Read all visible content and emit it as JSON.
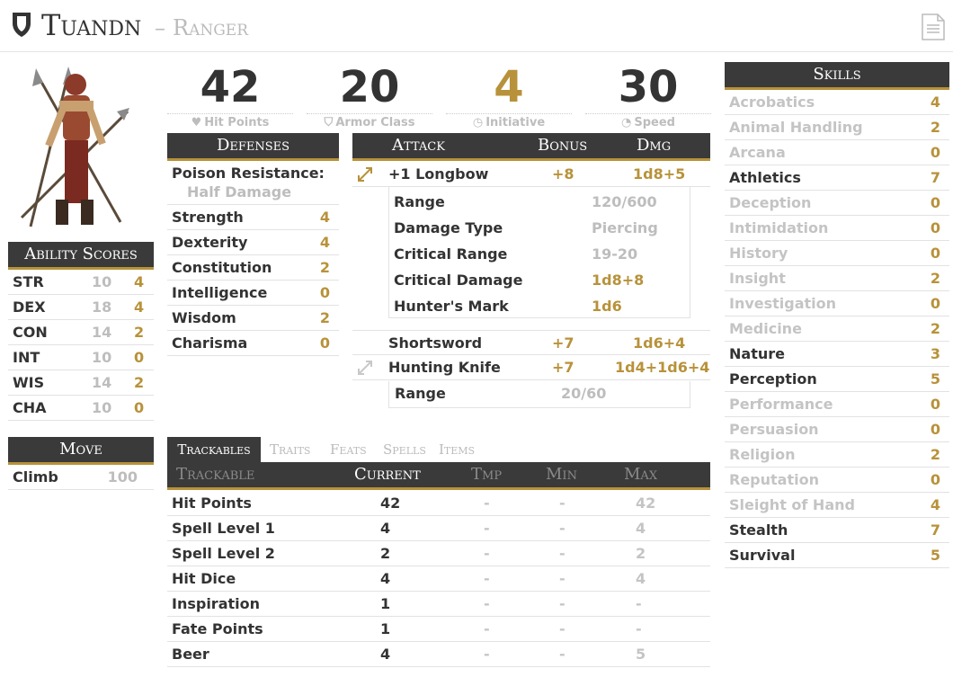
{
  "header": {
    "name": "Tuandn",
    "cls": "Ranger"
  },
  "stats": [
    {
      "value": "42",
      "label": "Hit Points",
      "color": "#333333"
    },
    {
      "value": "20",
      "label": "Armor Class",
      "color": "#333333"
    },
    {
      "value": "4",
      "label": "Initiative",
      "color": "#b8923a"
    },
    {
      "value": "30",
      "label": "Speed",
      "color": "#333333"
    }
  ],
  "ability": {
    "title": "Ability Scores",
    "rows": [
      {
        "k": "STR",
        "score": "10",
        "mod": "4"
      },
      {
        "k": "DEX",
        "score": "18",
        "mod": "4"
      },
      {
        "k": "CON",
        "score": "14",
        "mod": "2"
      },
      {
        "k": "INT",
        "score": "10",
        "mod": "0"
      },
      {
        "k": "WIS",
        "score": "14",
        "mod": "2"
      },
      {
        "k": "CHA",
        "score": "10",
        "mod": "0"
      }
    ]
  },
  "move": {
    "title": "Move",
    "rows": [
      {
        "k": "Climb",
        "v": "100"
      }
    ]
  },
  "defenses": {
    "title": "Defenses",
    "resist_label": "Poison Resistance:",
    "resist_value": "Half Damage",
    "rows": [
      {
        "k": "Strength",
        "v": "4"
      },
      {
        "k": "Dexterity",
        "v": "4"
      },
      {
        "k": "Constitution",
        "v": "2"
      },
      {
        "k": "Intelligence",
        "v": "0"
      },
      {
        "k": "Wisdom",
        "v": "2"
      },
      {
        "k": "Charisma",
        "v": "0"
      }
    ]
  },
  "attack": {
    "h_attack": "Attack",
    "h_bonus": "Bonus",
    "h_dmg": "Dmg",
    "longbow": {
      "name": "+1 Longbow",
      "bonus": "+8",
      "dmg": "1d8+5"
    },
    "longbow_details": [
      {
        "k": "Range",
        "v": "120/600",
        "gold": false
      },
      {
        "k": "Damage Type",
        "v": "Piercing",
        "gold": false
      },
      {
        "k": "Critical Range",
        "v": "19-20",
        "gold": false
      },
      {
        "k": "Critical Damage",
        "v": "1d8+8",
        "gold": true
      },
      {
        "k": "Hunter's Mark",
        "v": "1d6",
        "gold": true
      }
    ],
    "shortsword": {
      "name": "Shortsword",
      "bonus": "+7",
      "dmg": "1d6+4"
    },
    "knife": {
      "name": "Hunting Knife",
      "bonus": "+7",
      "dmg": "1d4+1d6+4"
    },
    "knife_details": [
      {
        "k": "Range",
        "v": "20/60"
      }
    ]
  },
  "tabs": [
    "Trackables",
    "Traits",
    "Feats",
    "Spells",
    "Items"
  ],
  "trackables": {
    "h": [
      "Trackable",
      "Current",
      "Tmp",
      "Min",
      "Max"
    ],
    "rows": [
      {
        "k": "Hit Points",
        "cur": "42",
        "tmp": "-",
        "min": "-",
        "max": "42"
      },
      {
        "k": "Spell Level 1",
        "cur": "4",
        "tmp": "-",
        "min": "-",
        "max": "4"
      },
      {
        "k": "Spell Level 2",
        "cur": "2",
        "tmp": "-",
        "min": "-",
        "max": "2"
      },
      {
        "k": "Hit Dice",
        "cur": "4",
        "tmp": "-",
        "min": "-",
        "max": "4"
      },
      {
        "k": "Inspiration",
        "cur": "1",
        "tmp": "-",
        "min": "-",
        "max": "-"
      },
      {
        "k": "Fate Points",
        "cur": "1",
        "tmp": "-",
        "min": "-",
        "max": "-"
      },
      {
        "k": "Beer",
        "cur": "4",
        "tmp": "-",
        "min": "-",
        "max": "5"
      }
    ]
  },
  "skills": {
    "title": "Skills",
    "rows": [
      {
        "k": "Acrobatics",
        "v": "4",
        "prof": false
      },
      {
        "k": "Animal Handling",
        "v": "2",
        "prof": false
      },
      {
        "k": "Arcana",
        "v": "0",
        "prof": false
      },
      {
        "k": "Athletics",
        "v": "7",
        "prof": true
      },
      {
        "k": "Deception",
        "v": "0",
        "prof": false
      },
      {
        "k": "Intimidation",
        "v": "0",
        "prof": false
      },
      {
        "k": "History",
        "v": "0",
        "prof": false
      },
      {
        "k": "Insight",
        "v": "2",
        "prof": false
      },
      {
        "k": "Investigation",
        "v": "0",
        "prof": false
      },
      {
        "k": "Medicine",
        "v": "2",
        "prof": false
      },
      {
        "k": "Nature",
        "v": "3",
        "prof": true
      },
      {
        "k": "Perception",
        "v": "5",
        "prof": true
      },
      {
        "k": "Performance",
        "v": "0",
        "prof": false
      },
      {
        "k": "Persuasion",
        "v": "0",
        "prof": false
      },
      {
        "k": "Religion",
        "v": "2",
        "prof": false
      },
      {
        "k": "Reputation",
        "v": "0",
        "prof": false
      },
      {
        "k": "Sleight of Hand",
        "v": "4",
        "prof": false
      },
      {
        "k": "Stealth",
        "v": "7",
        "prof": true
      },
      {
        "k": "Survival",
        "v": "5",
        "prof": true
      }
    ]
  }
}
